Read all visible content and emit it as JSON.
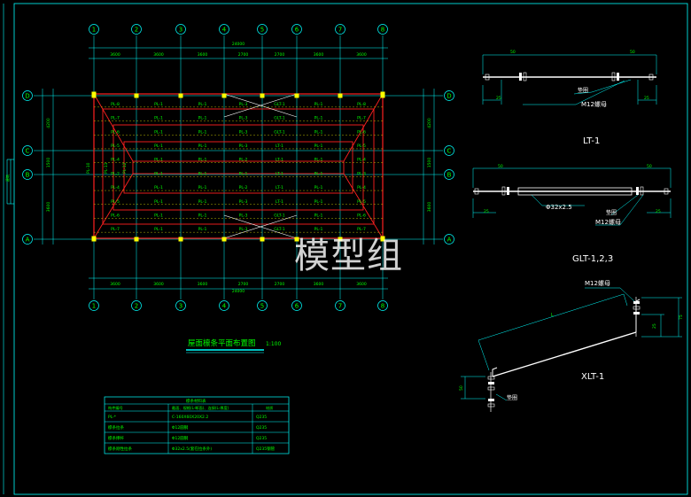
{
  "plan": {
    "grid_cols": [
      "1",
      "2",
      "3",
      "4",
      "5",
      "6",
      "7",
      "8"
    ],
    "grid_rows": [
      "D",
      "C",
      "B",
      "A"
    ],
    "top_dims": [
      "3600",
      "3600",
      "3600",
      "2700",
      "2700",
      "3600",
      "3600"
    ],
    "bottom_dims": [
      "3600",
      "3600",
      "3600",
      "2700",
      "2700",
      "3600",
      "3600"
    ],
    "total_top": "24000",
    "total_bottom": "24000",
    "left_dims": [
      "4200",
      "1500",
      "3600"
    ],
    "right_dims": [
      "4200",
      "1500",
      "3600"
    ],
    "rows": [
      [
        "PL-8",
        "PL-1",
        "PL-1",
        "PL-3",
        "GLT-1",
        "PL-1",
        "PL-8"
      ],
      [
        "PL-7",
        "PL-1",
        "PL-1",
        "PL-3",
        "GLT-1",
        "PL-1",
        "PL-7"
      ],
      [
        "PL-6",
        "PL-1",
        "PL-1",
        "PL-3",
        "GLT-1",
        "PL-1",
        "PL-6"
      ],
      [
        "PL-5",
        "PL-1",
        "PL-1",
        "PL-3",
        "LT-1",
        "PL-1",
        "PL-5"
      ],
      [
        "PL-4",
        "PL-1",
        "PL-1",
        "PL-2",
        "LT-1",
        "PL-1",
        "PL-4"
      ],
      [
        "PL-2",
        "PL-1",
        "PL-1",
        "PL-1",
        "LT-1",
        "PL-1",
        "PL-3"
      ],
      [
        "PL-4",
        "PL-1",
        "PL-1",
        "PL-2",
        "LT-1",
        "PL-1",
        "PL-4"
      ],
      [
        "PL-5",
        "PL-1",
        "PL-1",
        "PL-3",
        "LT-1",
        "PL-1",
        "PL-5"
      ],
      [
        "PL-6",
        "PL-1",
        "PL-1",
        "PL-3",
        "GLT-1",
        "PL-1",
        "PL-6"
      ],
      [
        "PL-7",
        "PL-1",
        "PL-1",
        "PL-3",
        "GLT-1",
        "PL-1",
        "PL-7"
      ]
    ],
    "side_labels": [
      "PL-10",
      "PL-11",
      "PL-12"
    ],
    "title": "屋面檩条平面布置图",
    "scale": "1:100"
  },
  "details": {
    "lt1": {
      "title": "LT-1",
      "dim_left": "50",
      "dim_right": "50",
      "dim_h": "25",
      "washer": "垫圈",
      "nut": "M12螺母"
    },
    "glt": {
      "title": "GLT-1,2,3",
      "dim_left": "50",
      "dim_right": "50",
      "dim_h": "25",
      "pipe": "Φ32x2.5",
      "washer": "垫圈",
      "nut": "M12螺母"
    },
    "xlt1": {
      "title": "XLT-1",
      "nut": "M12螺母",
      "washer": "垫圈",
      "len": "L",
      "dim_a": "75",
      "dim_b": "50",
      "dim_c": "25"
    }
  },
  "table": {
    "title": "檩条材料表",
    "headers": [
      "构件编号",
      "截面、规格(L-断面)、连接(L-厚度)",
      "材质"
    ],
    "rows": [
      [
        "PL-*",
        "C-160X60X20X2.2",
        "Q235"
      ],
      [
        "檩条拉条",
        "Φ12圆钢",
        "Q235"
      ],
      [
        "檩条撑杆",
        "Φ12圆钢",
        "Q235"
      ],
      [
        "檩条刚性拉条",
        "Φ32x2.5(套在拉条外)",
        "Q235钢管"
      ]
    ]
  },
  "watermark": "模型组",
  "colors": {
    "bg": "#000000",
    "cyan": "#00ffff",
    "yellow": "#ffff00",
    "red": "#ff2020",
    "green": "#00ff00",
    "white": "#ffffff"
  }
}
